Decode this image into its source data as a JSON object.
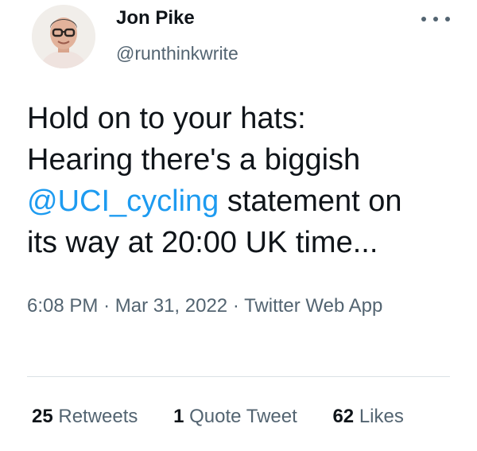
{
  "author": {
    "display_name": "Jon Pike",
    "handle": "@runthinkwrite",
    "avatar_icon": "profile-photo"
  },
  "more_icon": "ellipsis-icon",
  "tweet": {
    "line1": "Hold on to your hats:",
    "line2": "Hearing there's a biggish",
    "mention": "@UCI_cycling",
    "line3_rest": " statement on",
    "line4": "its way at 20:00 UK time..."
  },
  "meta": {
    "time": "6:08 PM",
    "separator": "·",
    "date": "Mar 31, 2022",
    "source": "Twitter Web App"
  },
  "stats": {
    "retweets_count": "25",
    "retweets_label": "Retweets",
    "quotes_count": "1",
    "quotes_label": "Quote Tweet",
    "likes_count": "62",
    "likes_label": "Likes"
  },
  "colors": {
    "link": "#1d9bf0",
    "secondary_text": "#536471",
    "primary_text": "#0f1419"
  }
}
